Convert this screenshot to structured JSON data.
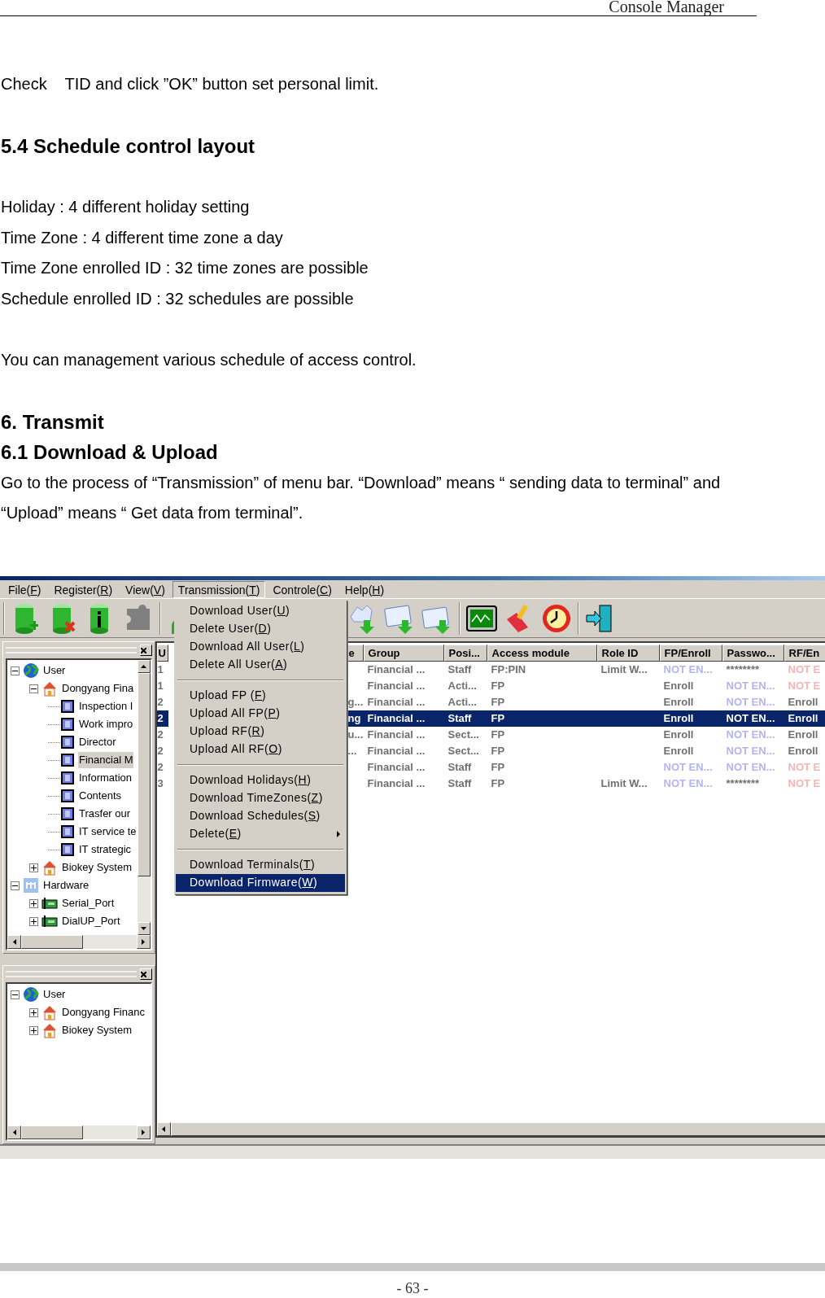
{
  "document": {
    "header": "Console Manager",
    "sections": [
      [
        {
          "kind": "para",
          "text": "Check    TID and click ”OK” button set personal limit."
        }
      ],
      [
        {
          "kind": "heading",
          "text": "5.4 Schedule control layout"
        }
      ],
      [
        {
          "kind": "para",
          "text": "Holiday : 4 different holiday setting"
        },
        {
          "kind": "para",
          "text": "Time Zone : 4 different time zone a day"
        },
        {
          "kind": "para",
          "text": "Time Zone enrolled ID : 32 time zones are possible"
        },
        {
          "kind": "para",
          "text": "Schedule enrolled ID : 32 schedules are possible"
        }
      ],
      [
        {
          "kind": "para",
          "text": "You can management various schedule of access control."
        }
      ],
      [
        {
          "kind": "heading",
          "text": "6. Transmit"
        },
        {
          "kind": "heading",
          "text": "6.1 Download & Upload"
        },
        {
          "kind": "para",
          "text": "Go to the process of “Transmission” of menu bar. “Download” means “ sending data to terminal” and “Upload” means “ Get data from terminal”."
        }
      ]
    ],
    "page_number": "- 63 -"
  },
  "app": {
    "menu_bar": [
      {
        "label": "File(F)",
        "selected": false
      },
      {
        "label": "Register(R)",
        "selected": false
      },
      {
        "label": "View(V)",
        "selected": false
      },
      {
        "label": "Transmission(T)",
        "selected": true
      },
      {
        "label": "Controle(C)",
        "selected": false
      },
      {
        "label": "Help(H)",
        "selected": false
      }
    ],
    "dropdown": [
      {
        "kind": "item",
        "label": "Download User(U)",
        "selected": false
      },
      {
        "kind": "item",
        "label": "Delete User(D)",
        "selected": false
      },
      {
        "kind": "item",
        "label": "Download All User(L)",
        "selected": false
      },
      {
        "kind": "item",
        "label": "Delete All User(A)",
        "selected": false
      },
      {
        "kind": "separator"
      },
      {
        "kind": "item",
        "label": "Upload FP (F)",
        "selected": false
      },
      {
        "kind": "item",
        "label": "Upload All FP(P)",
        "selected": false
      },
      {
        "kind": "item",
        "label": "Upload RF(R)",
        "selected": false
      },
      {
        "kind": "item",
        "label": "Upload All RF(O)",
        "selected": false
      },
      {
        "kind": "separator"
      },
      {
        "kind": "item",
        "label": "Download Holidays(H)",
        "selected": false
      },
      {
        "kind": "item",
        "label": "Download TimeZones(Z)",
        "selected": false
      },
      {
        "kind": "item",
        "label": "Download Schedules(S)",
        "selected": false
      },
      {
        "kind": "submenu",
        "label": "Delete(E)",
        "selected": false
      },
      {
        "kind": "separator"
      },
      {
        "kind": "item",
        "label": "Download Terminals(T)",
        "selected": false
      },
      {
        "kind": "item",
        "label": "Download Firmware(W)",
        "selected": true
      }
    ],
    "tree_top": [
      {
        "label": "User",
        "kind": "globe",
        "expanded": true,
        "selected": false,
        "children": [
          {
            "label": "Dongyang Fina",
            "kind": "house",
            "expanded": true,
            "selected": false,
            "children": [
              {
                "label": "Inspection I",
                "kind": "group",
                "selected": false
              },
              {
                "label": "Work impro",
                "kind": "group",
                "selected": false
              },
              {
                "label": "Director",
                "kind": "group",
                "selected": false
              },
              {
                "label": "Financial M",
                "kind": "group",
                "selected": true
              },
              {
                "label": "Information",
                "kind": "group",
                "selected": false
              },
              {
                "label": "Contents",
                "kind": "group",
                "selected": false
              },
              {
                "label": "Trasfer our",
                "kind": "group",
                "selected": false
              },
              {
                "label": "IT service te",
                "kind": "group",
                "selected": false
              },
              {
                "label": "IT strategic",
                "kind": "group",
                "selected": false
              }
            ]
          },
          {
            "label": "Biokey System",
            "kind": "house",
            "expanded": false,
            "selected": false
          }
        ]
      },
      {
        "label": "Hardware",
        "kind": "hardware",
        "expanded": true,
        "selected": false,
        "children": [
          {
            "label": "Serial_Port",
            "kind": "port",
            "expanded": false,
            "selected": false
          },
          {
            "label": "DialUP_Port",
            "kind": "port",
            "expanded": false,
            "selected": false
          }
        ]
      }
    ],
    "tree_bottom": [
      {
        "label": "User",
        "kind": "globe",
        "expanded": true,
        "selected": false,
        "children": [
          {
            "label": "Dongyang Financ",
            "kind": "house",
            "expanded": false,
            "selected": false
          },
          {
            "label": "Biokey System",
            "kind": "house",
            "expanded": false,
            "selected": false
          }
        ]
      }
    ],
    "table": {
      "columns": [
        "U",
        "e",
        "Group",
        "Posi...",
        "Access module",
        "Role ID",
        "FP/Enroll",
        "Passwo...",
        "RF/En"
      ],
      "rows": [
        {
          "index": "1",
          "group": "Financial ...",
          "position": "Staff",
          "access": "FP:PIN",
          "role": "Limit W...",
          "fp": "NOT EN...",
          "fp_enrolled": false,
          "password": "********",
          "password_enrolled": true,
          "rf": "NOT E",
          "rf_enrolled": false,
          "selected": false
        },
        {
          "index": "1",
          "group": "Financial ...",
          "position": "Acti...",
          "access": "FP",
          "fp": "Enroll",
          "fp_enrolled": true,
          "password": "NOT EN...",
          "password_enrolled": false,
          "rf": "NOT E",
          "rf_enrolled": false,
          "selected": false
        },
        {
          "index": "2",
          "name": "g...",
          "group": "Financial ...",
          "position": "Acti...",
          "access": "FP",
          "fp": "Enroll",
          "fp_enrolled": true,
          "password": "NOT EN...",
          "password_enrolled": false,
          "rf": "Enroll",
          "rf_enrolled": true,
          "selected": false
        },
        {
          "index": "2",
          "name": "ng",
          "group": "Financial ...",
          "position": "Staff",
          "access": "FP",
          "fp": "Enroll",
          "fp_enrolled": true,
          "password": "NOT EN...",
          "password_enrolled": false,
          "rf": "Enroll",
          "rf_enrolled": true,
          "selected": true
        },
        {
          "index": "2",
          "name": "u...",
          "group": "Financial ...",
          "position": "Sect...",
          "access": "FP",
          "fp": "Enroll",
          "fp_enrolled": true,
          "password": "NOT EN...",
          "password_enrolled": false,
          "rf": "Enroll",
          "rf_enrolled": true,
          "selected": false
        },
        {
          "index": "2",
          "name": "...",
          "group": "Financial ...",
          "position": "Sect...",
          "access": "FP",
          "fp": "Enroll",
          "fp_enrolled": true,
          "password": "NOT EN...",
          "password_enrolled": false,
          "rf": "Enroll",
          "rf_enrolled": true,
          "selected": false
        },
        {
          "index": "2",
          "group": "Financial ...",
          "position": "Staff",
          "access": "FP",
          "fp": "NOT EN...",
          "fp_enrolled": false,
          "password": "NOT EN...",
          "password_enrolled": false,
          "rf": "NOT E",
          "rf_enrolled": false,
          "selected": false
        },
        {
          "index": "3",
          "group": "Financial ...",
          "position": "Staff",
          "access": "FP",
          "role": "Limit W...",
          "fp": "NOT EN...",
          "fp_enrolled": false,
          "password": "********",
          "password_enrolled": true,
          "rf": "NOT E",
          "rf_enrolled": false,
          "selected": false
        }
      ]
    }
  }
}
